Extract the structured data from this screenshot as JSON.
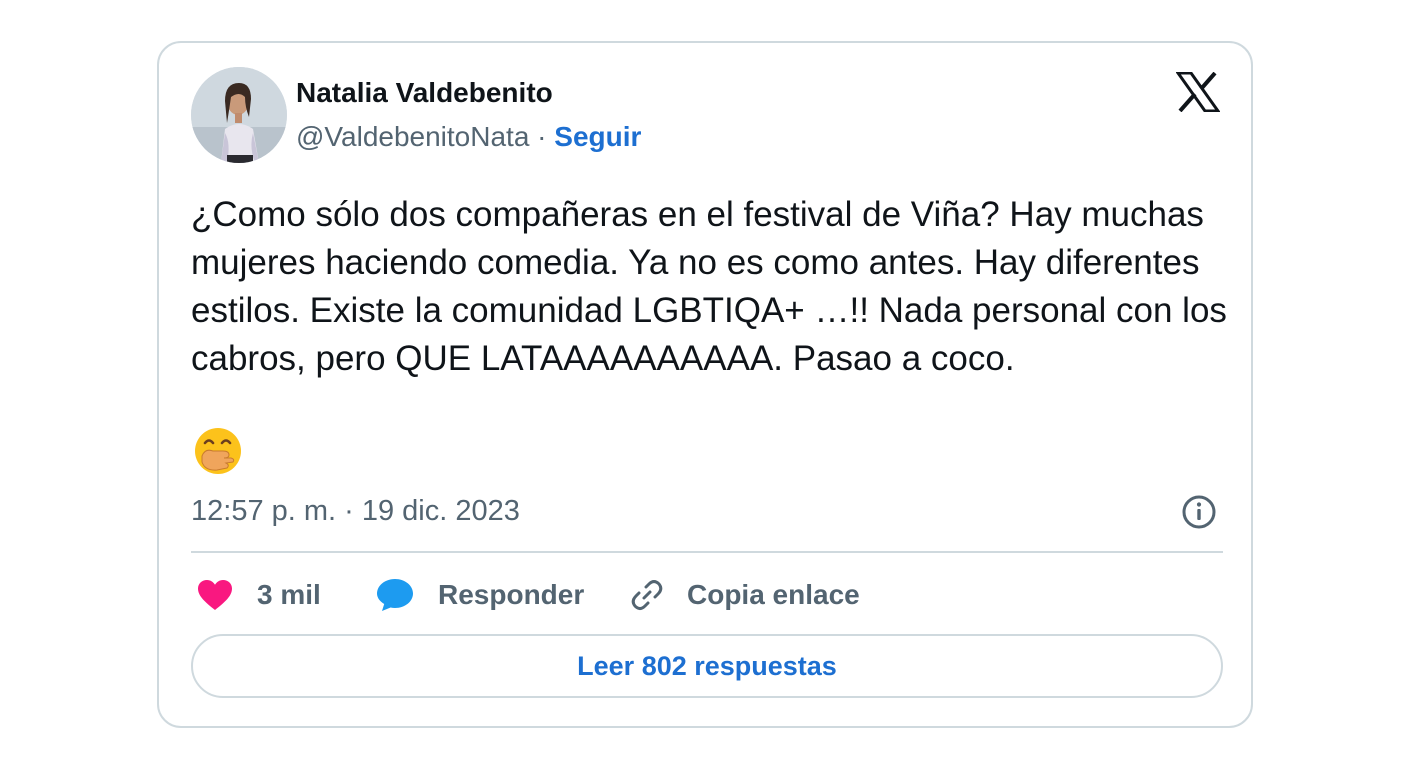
{
  "author": {
    "name": "Natalia Valdebenito",
    "handle": "@ValdebenitoNata",
    "separator": " · ",
    "follow_label": "Seguir"
  },
  "tweet": {
    "text": "¿Como sólo dos compañeras en el festival de Viña? Hay muchas mujeres haciendo comedia. Ya no es como antes. Hay diferentes estilos. Existe la comunidad LGBTIQA+ …!! Nada personal con los cabros, pero QUE LATAAAAAAAAAA. Pasao a coco.",
    "emoji": "face-with-hand-over-mouth",
    "timestamp": "12:57 p. m. · 19 dic. 2023"
  },
  "actions": {
    "likes_count": "3 mil",
    "reply_label": "Responder",
    "copy_link_label": "Copia enlace"
  },
  "read_replies_label": "Leer 802 respuestas",
  "icons": {
    "brand": "x-logo-icon",
    "info": "info-icon",
    "like": "heart-icon",
    "reply": "speech-bubble-icon",
    "copy": "link-icon"
  },
  "colors": {
    "text": "#0f1419",
    "secondary": "#536471",
    "link": "#1d6fd1",
    "heart": "#f91880",
    "reply_bubble": "#1d9bf0",
    "border": "#cfd9de"
  }
}
